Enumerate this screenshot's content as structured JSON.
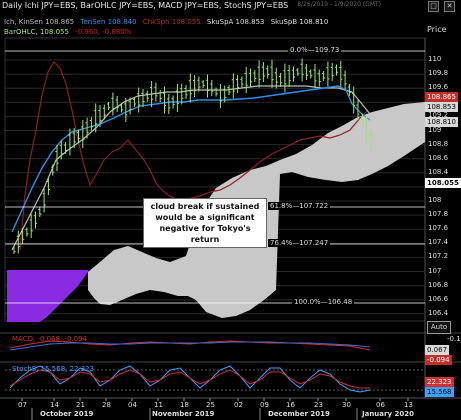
{
  "window": {
    "title": "Daily Ichi JPY=EBS, BarOHLC JPY=EBS, MACD JPY=EBS, StochS JPY=EBS",
    "range": "8/26/2019 - 1/9/2020 (GMT)",
    "expand_icon": "maximize-icon",
    "close_icon": "close-icon"
  },
  "legend": {
    "row1": [
      {
        "text": "Ich, KinSen 108.865",
        "color": "#bdbdbd"
      },
      {
        "text": "TenSen 108.840",
        "color": "#2f8fe8"
      },
      {
        "text": "ChkSpn 108.055",
        "color": "#b03030"
      },
      {
        "text": "SkuSpA 108.853",
        "color": "#dddddd"
      },
      {
        "text": "SkuSpB 108.810",
        "color": "#dddddd"
      }
    ],
    "row2": [
      {
        "text": "BarOHLC, 108.055",
        "color": "#9be870"
      },
      {
        "text": "-0.960, -0.880%",
        "color": "#d02020"
      }
    ]
  },
  "price_axis": {
    "header": "Price",
    "ticks": [
      "110",
      "109.8",
      "109.6",
      "109.4",
      "109.2",
      "109",
      "108.8",
      "108.6",
      "108.4",
      "108.2",
      "108",
      "107.8",
      "107.6",
      "107.4",
      "107.2",
      "107",
      "106.8",
      "106.6",
      "106.4"
    ],
    "badges": [
      {
        "text": "108.865",
        "bg": "#c0302a",
        "fg": "#ffffff"
      },
      {
        "text": "108.853",
        "bg": "#d8d8d8",
        "fg": "#000000"
      },
      {
        "text": "108.810",
        "bg": "#d8d8d8",
        "fg": "#000000"
      },
      {
        "text": "108.055",
        "bg": "#ffffff",
        "fg": "#000000"
      }
    ],
    "auto_label": "Auto"
  },
  "fib_levels": [
    {
      "label": "0.0%",
      "value": "109.73"
    },
    {
      "label": "61.8%",
      "value": "107.722"
    },
    {
      "label": "76.4%",
      "value": "107.247"
    },
    {
      "label": "100.0%",
      "value": "106.48"
    }
  ],
  "annotation": "cloud break if sustained would be a significant negative for Tokyo's return",
  "macd": {
    "label": "MACD, -0.068, -0.094",
    "badge_top": "0.067",
    "badge_mid": "-0.094",
    "badge_low": "-0.1"
  },
  "stoch": {
    "label": "StochS, 15.568, 22.323",
    "badge_top": "22.323",
    "badge_mid": "15.568"
  },
  "time_axis": {
    "dates": [
      "07",
      "14",
      "21",
      "28",
      "04",
      "11",
      "18",
      "25",
      "02",
      "09",
      "16",
      "23",
      "30",
      "06",
      "13"
    ],
    "months": [
      "October 2019",
      "November 2019",
      "December 2019",
      "January 2020"
    ]
  },
  "colors": {
    "bars": "#9be870",
    "tenkan": "#2f8fe8",
    "kijun": "#bdbdbd",
    "chikou": "#b03030",
    "cloud_bear": "#c8c8c8",
    "cloud_bull": "#8a2be2",
    "fib": "#ffffff"
  }
}
